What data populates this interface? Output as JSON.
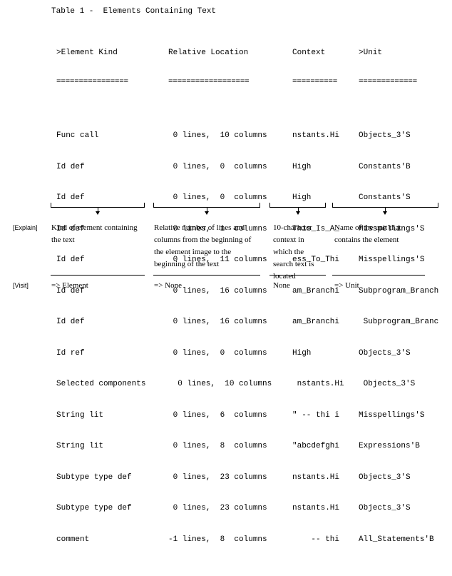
{
  "title": "Table 1 -  Elements Containing Text",
  "columns": {
    "kind": {
      "header": ">Element Kind",
      "separator": "================"
    },
    "location": {
      "header": "Relative Location",
      "separator": "=================="
    },
    "context": {
      "header": "Context",
      "separator": "=========="
    },
    "unit": {
      "header": ">Unit",
      "separator": "============="
    }
  },
  "rows": [
    {
      "kind": "Func call",
      "loc": " 0 lines,  10 columns",
      "ctx": "nstants.Hi",
      "unit": "Objects_3'S"
    },
    {
      "kind": "Id def",
      "loc": " 0 lines,  0  columns",
      "ctx": "High",
      "unit": "Constants'B"
    },
    {
      "kind": "Id def",
      "loc": " 0 lines,  0  columns",
      "ctx": "High",
      "unit": "Constants'S"
    },
    {
      "kind": "Id def",
      "loc": " 0 lines,  1  columns",
      "ctx": "This_Is_A_",
      "unit": "Misspellings'S"
    },
    {
      "kind": "Id def",
      "loc": " 0 lines,  11 columns",
      "ctx": "ess_To_Thi",
      "unit": "Misspellings'S"
    },
    {
      "kind": "Id def",
      "loc": " 0 lines,  16 columns",
      "ctx": "am_Branchi",
      "unit": "Subprogram_Branch"
    },
    {
      "kind": "Id def",
      "loc": " 0 lines,  16 columns",
      "ctx": "am_Branchi",
      "unit": " Subprogram_Branc"
    },
    {
      "kind": "Id ref",
      "loc": " 0 lines,  0  columns",
      "ctx": "High",
      "unit": "Objects_3'S"
    },
    {
      "kind": "Selected components",
      "loc": "  0 lines,  10 columns",
      "ctx": " nstants.Hi",
      "unit": " Objects_3'S"
    },
    {
      "kind": "String lit",
      "loc": " 0 lines,  6  columns",
      "ctx": "\" -- thi i",
      "unit": "Misspellings'S"
    },
    {
      "kind": "String lit",
      "loc": " 0 lines,  8  columns",
      "ctx": "\"abcdefghi",
      "unit": "Expressions'B"
    },
    {
      "kind": "Subtype type def",
      "loc": " 0 lines,  23 columns",
      "ctx": "nstants.Hi",
      "unit": "Objects_3'S"
    },
    {
      "kind": "Subtype type def",
      "loc": " 0 lines,  23 columns",
      "ctx": "nstants.Hi",
      "unit": "Objects_3'S"
    },
    {
      "kind": "comment",
      "loc": "-1 lines,  8  columns",
      "ctx": "    -- thi",
      "unit": "All_Statements'B"
    }
  ],
  "labels": {
    "explain": "[Explain]",
    "visit": "[Visit]"
  },
  "explain": {
    "kind": "Kind of element containing the text",
    "location": "Relative number of lines and columns from the beginning of the element image to the beginning of the text",
    "context": "10-character context in which the search text is located",
    "unit": "Name of the unit that contains the element"
  },
  "visit": {
    "kind": "=> Element",
    "location": "=> None",
    "context": "None",
    "unit": "=> Unit"
  }
}
